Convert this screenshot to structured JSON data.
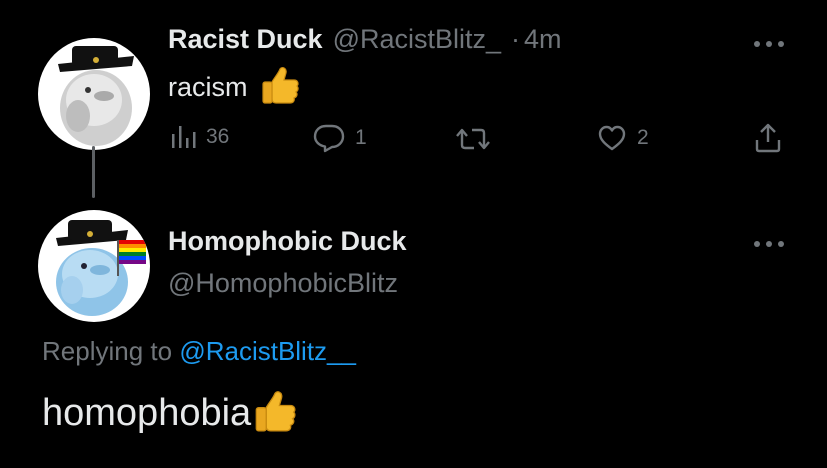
{
  "colors": {
    "background": "#000000",
    "primary_text": "#e7e9ea",
    "secondary_text": "#71767b",
    "link": "#1d9bf0",
    "thread_line": "#5c5f63"
  },
  "parent_tweet": {
    "display_name": "Racist Duck",
    "handle": "@RacistBlitz_",
    "separator": "·",
    "time": "4m",
    "text": "racism",
    "emoji_icon": "thumbs-up-icon",
    "more_icon": "more-options-icon",
    "actions": {
      "views": {
        "icon": "analytics-bars-icon",
        "count": "36"
      },
      "reply": {
        "icon": "reply-bubble-icon",
        "count": "1"
      },
      "retweet": {
        "icon": "retweet-icon",
        "count": ""
      },
      "like": {
        "icon": "heart-icon",
        "count": "2"
      },
      "share": {
        "icon": "share-upload-icon",
        "count": ""
      }
    }
  },
  "reply_tweet": {
    "display_name": "Homophobic Duck",
    "handle": "@HomophobicBlitz",
    "more_icon": "more-options-icon",
    "replying_prefix": "Replying to",
    "replying_to": "@RacistBlitz__",
    "text": "homophobia",
    "emoji_icon": "thumbs-up-icon"
  }
}
